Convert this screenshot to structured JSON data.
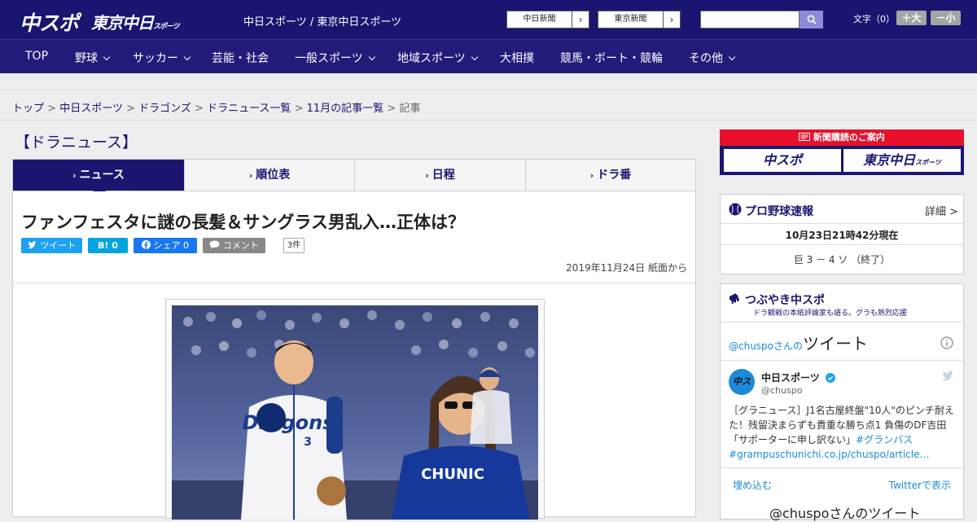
{
  "header": {
    "logo_primary": "中スポ",
    "logo_secondary": "東京中日",
    "logo_secondary_small": "スポーツ",
    "site_line": "中日スポーツ / 東京中日スポーツ",
    "ext_links": [
      {
        "label": "中日新聞",
        "arrow": "›"
      },
      {
        "label": "東京新聞",
        "arrow": "›"
      }
    ],
    "search_placeholder": "",
    "font_label": "文字（0）",
    "font_bigger": "＋大",
    "font_smaller": "－小"
  },
  "nav": {
    "items": [
      {
        "label": "TOP",
        "dropdown": false
      },
      {
        "label": "野球",
        "dropdown": true
      },
      {
        "label": "サッカー",
        "dropdown": true
      },
      {
        "label": "芸能・社会",
        "dropdown": false
      },
      {
        "label": "一般スポーツ",
        "dropdown": true
      },
      {
        "label": "地域スポーツ",
        "dropdown": true
      },
      {
        "label": "大相撲",
        "dropdown": false
      },
      {
        "label": "競馬・ボート・競輪",
        "dropdown": false
      },
      {
        "label": "その他",
        "dropdown": true
      }
    ]
  },
  "breadcrumb": {
    "items": [
      "トップ",
      "中日スポーツ",
      "ドラゴンズ",
      "ドラニュース一覧",
      "11月の記事一覧"
    ],
    "current": "記事",
    "separator": ">"
  },
  "section": {
    "title": "【ドラニュース】",
    "tabs": [
      {
        "label": "ニュース",
        "active": true
      },
      {
        "label": "順位表",
        "active": false
      },
      {
        "label": "日程",
        "active": false
      },
      {
        "label": "ドラ番",
        "active": false
      }
    ]
  },
  "article": {
    "headline": "ファンフェスタに謎の長髪＆サングラス男乱入…正体は？",
    "share": {
      "tweet": "ツイート",
      "hatena": "B!",
      "hatena_count": "0",
      "facebook": "シェア",
      "facebook_count": "0",
      "comment": "コメント",
      "comment_count": "3件"
    },
    "date": "2019年11月24日 紙面から",
    "photo": {
      "uniform_text": "CHUNIC",
      "jersey_number": "3",
      "jersey_script": "Dragons"
    }
  },
  "sidebar": {
    "ad": {
      "title": "新聞購読のご案内",
      "left": "中スポ",
      "right": "東京中日",
      "right_small": "スポーツ"
    },
    "baseball": {
      "title": "プロ野球速報",
      "detail": "詳細 >",
      "timestamp": "10月23日21時42分現在",
      "score": "巨 3 － 4 ソ （終了）"
    },
    "tweets": {
      "title": "つぶやき中スポ",
      "subtitle": "ドラ観戦の本紙評論家も語る。グラも熱烈応援",
      "widget_handle": "@chuspoさんの",
      "widget_title": "ツイート",
      "account_name": "中日スポーツ",
      "account_handle": "@chuspo",
      "tweet_text": "［グラニュース］J1名古屋終盤\"10人\"のピンチ耐えた！残留決まらずも貴重な勝ち点1 負傷のDF吉田「サポーターに申し訳ない」",
      "tweet_hashtag": "#グランパス",
      "tweet_link": "#grampuschunichi.co.jp/chuspo/article…",
      "embed": "埋め込む",
      "view_on_twitter": "Twitterで表示",
      "footer_partial": "@chuspoさんのツイート"
    }
  },
  "colors": {
    "navy": "#1a1570",
    "twitter": "#1da1f2",
    "hatena": "#00a4de",
    "facebook": "#1877f2",
    "comment": "#888888",
    "ad_red": "#e8102a"
  }
}
